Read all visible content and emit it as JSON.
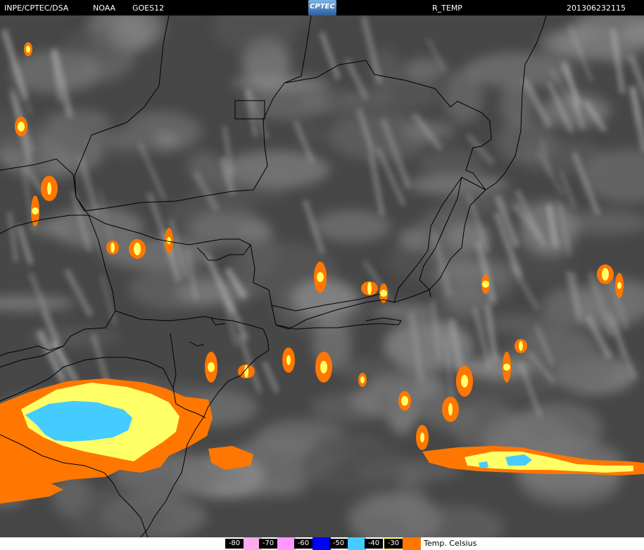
{
  "header": {
    "agency": "INPE/CPTEC/DSA",
    "source": "NOAA",
    "satellite": "GOES12",
    "logo_text": "CPTEC",
    "product": "R_TEMP",
    "timestamp": "201306232115"
  },
  "legend": {
    "unit_label": "Temp. Celsius",
    "stops": [
      {
        "label": "-80",
        "color": "#ffaaee"
      },
      {
        "label": "-70",
        "color": "#ff99ff"
      },
      {
        "label": "-60",
        "color": "#0000ff"
      },
      {
        "label": "-50",
        "color": "#44ccff"
      },
      {
        "label": "-40",
        "color": "#ffff66"
      },
      {
        "label": "-30",
        "color": "#ff7700"
      }
    ]
  },
  "colors": {
    "background": "#444444",
    "cloud": "#cccccc",
    "border_lines": "#000000"
  }
}
